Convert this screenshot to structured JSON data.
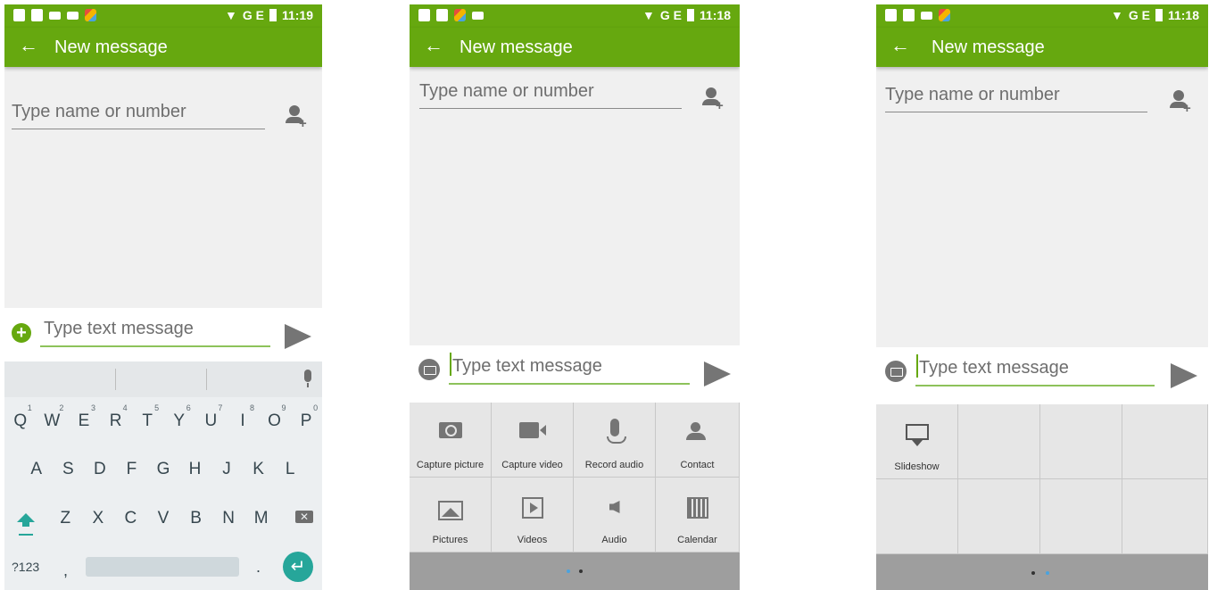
{
  "accent_color": "#66a80f",
  "screens": [
    {
      "status_bar": {
        "network": "G E",
        "time": "11:19"
      },
      "toolbar": {
        "title": "New message"
      },
      "to_field": {
        "placeholder": "Type name or number"
      },
      "compose": {
        "placeholder": "Type text message"
      },
      "keyboard": {
        "row1": [
          "Q",
          "W",
          "E",
          "R",
          "T",
          "Y",
          "U",
          "I",
          "O",
          "P"
        ],
        "row1_hints": [
          "1",
          "2",
          "3",
          "4",
          "5",
          "6",
          "7",
          "8",
          "9",
          "0"
        ],
        "row2": [
          "A",
          "S",
          "D",
          "F",
          "G",
          "H",
          "J",
          "K",
          "L"
        ],
        "row3": [
          "Z",
          "X",
          "C",
          "V",
          "B",
          "N",
          "M"
        ],
        "symbols_label": "?123",
        "comma": ",",
        "period": "."
      }
    },
    {
      "status_bar": {
        "network": "G E",
        "time": "11:18"
      },
      "toolbar": {
        "title": "New message"
      },
      "to_field": {
        "placeholder": "Type name or number"
      },
      "compose": {
        "placeholder": "Type text message"
      },
      "attachments": [
        {
          "label": "Capture picture",
          "icon": "camera-icon"
        },
        {
          "label": "Capture video",
          "icon": "video-camera-icon"
        },
        {
          "label": "Record audio",
          "icon": "microphone-icon"
        },
        {
          "label": "Contact",
          "icon": "contact-icon"
        },
        {
          "label": "Pictures",
          "icon": "picture-icon"
        },
        {
          "label": "Videos",
          "icon": "video-file-icon"
        },
        {
          "label": "Audio",
          "icon": "speaker-icon"
        },
        {
          "label": "Calendar",
          "icon": "calendar-icon"
        }
      ]
    },
    {
      "status_bar": {
        "network": "G E",
        "time": "11:18"
      },
      "toolbar": {
        "title": "New message"
      },
      "to_field": {
        "placeholder": "Type name or number"
      },
      "compose": {
        "placeholder": "Type text message"
      },
      "attachments": [
        {
          "label": "Slideshow",
          "icon": "slideshow-icon"
        }
      ]
    }
  ]
}
